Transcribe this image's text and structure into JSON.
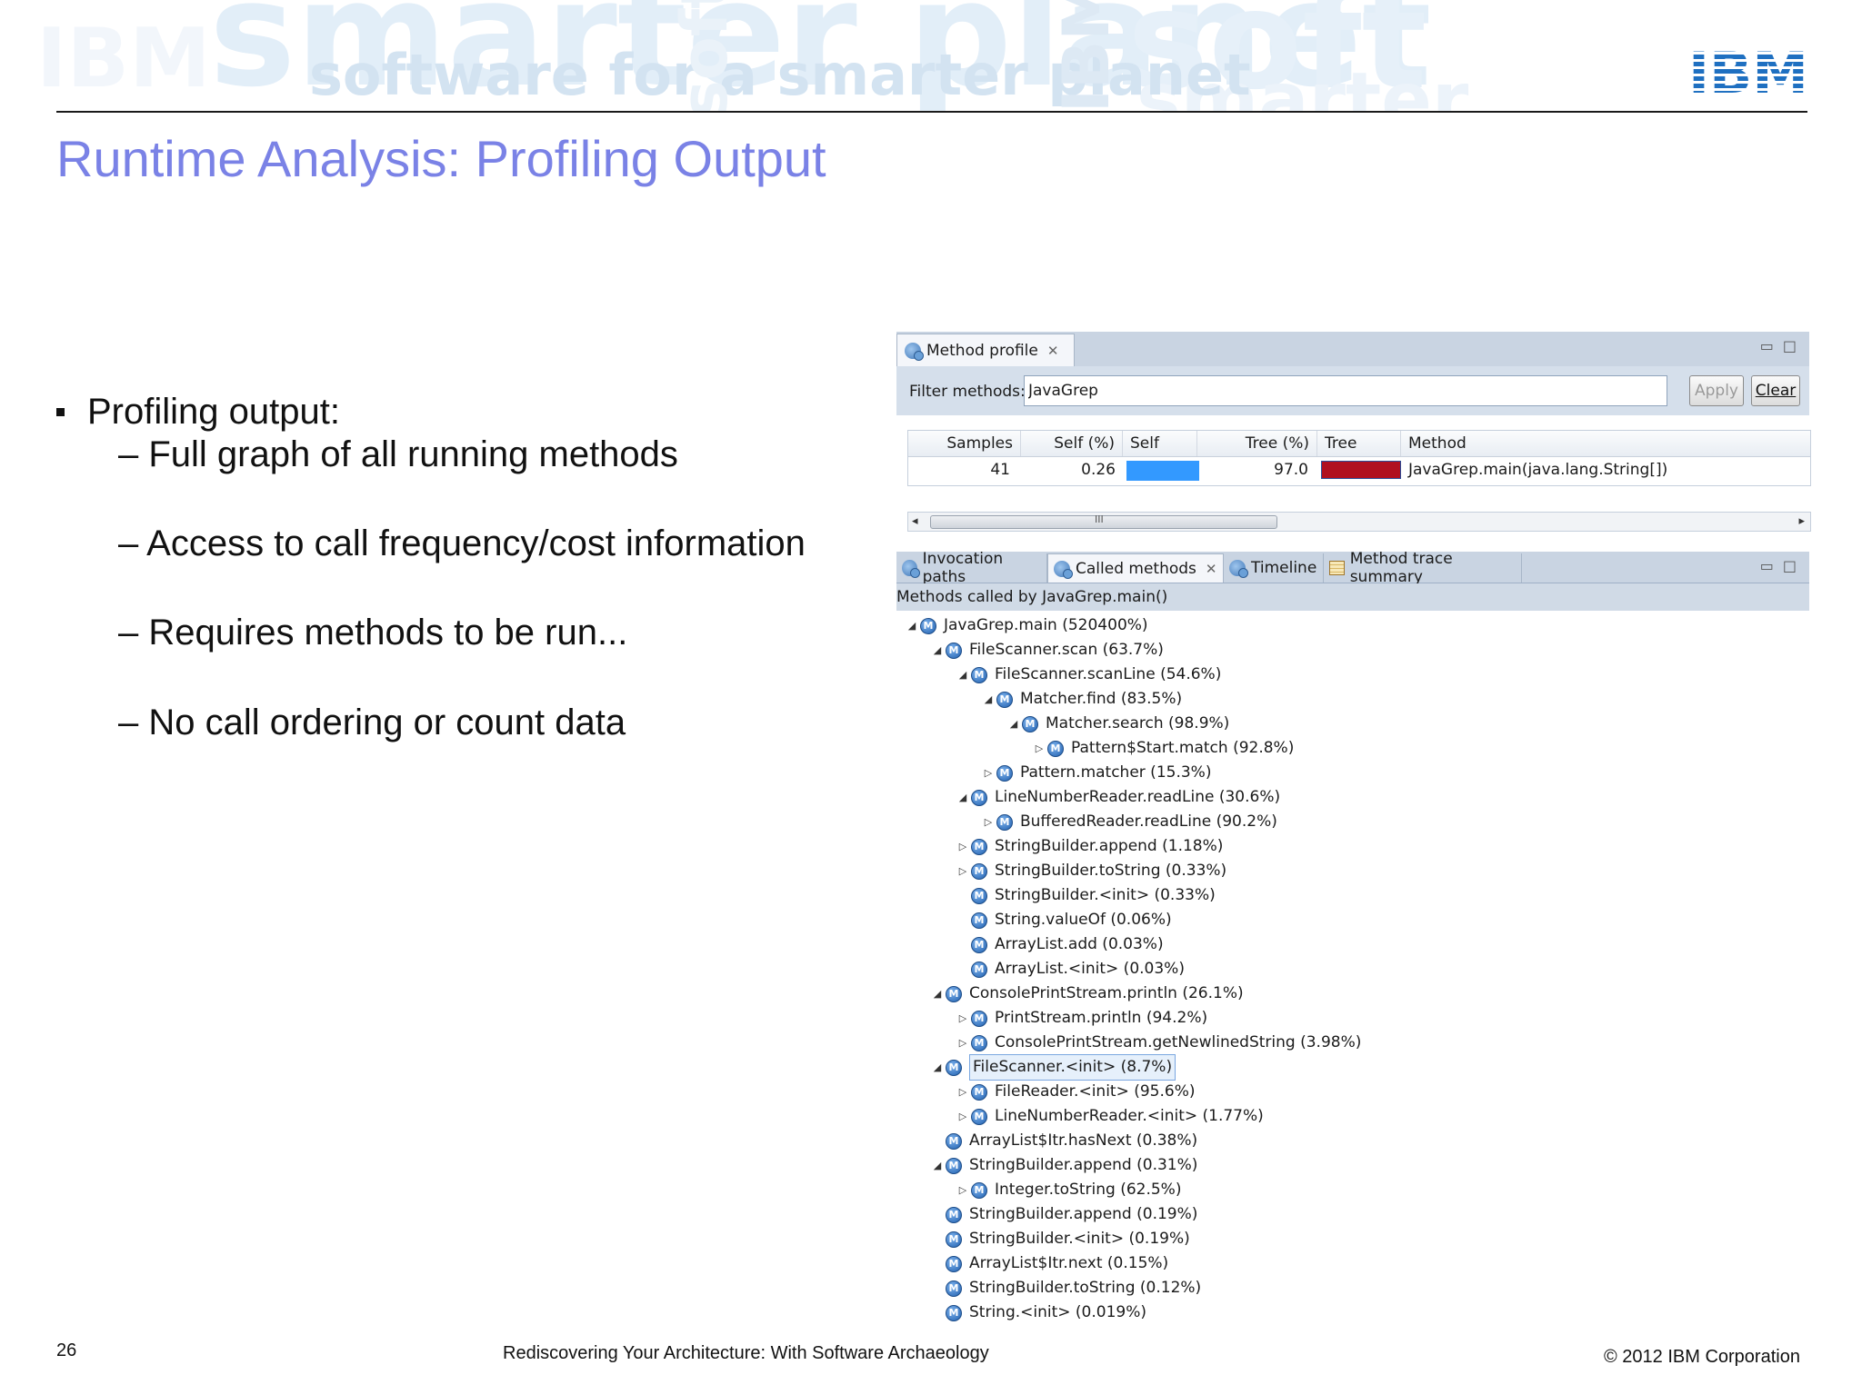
{
  "banner": {
    "watermark_1": "smarter planet",
    "watermark_2": "soft",
    "watermark_3": "software for a smarter planet",
    "watermark_4": "smarter",
    "watermark_5": "soft",
    "watermark_6": "IBM",
    "watermark_7": "IBM",
    "logo_text": "IBM"
  },
  "slide": {
    "title": "Runtime Analysis: Profiling Output",
    "bullet": "Profiling output:",
    "subbullets": [
      "– Full graph of all running methods",
      "– Access to call frequency/cost information",
      "– Requires methods to be run...",
      "– No call ordering or count data"
    ]
  },
  "profile_view": {
    "tab_label": "Method profile",
    "filter_label": "Filter methods:",
    "filter_value": "JavaGrep",
    "apply_label": "Apply",
    "clear_label": "Clear",
    "columns": [
      "Samples",
      "Self (%)",
      "Self",
      "Tree (%)",
      "Tree",
      "Method"
    ],
    "row": {
      "samples": "41",
      "self_pct": "0.26",
      "tree_pct": "97.0",
      "method": "JavaGrep.main(java.lang.String[])"
    },
    "scroll_thumb_glyph": "III"
  },
  "called_view": {
    "tabs": [
      "Invocation paths",
      "Called methods",
      "Timeline",
      "Method trace summary"
    ],
    "header": "Methods called by JavaGrep.main()",
    "nodes": [
      {
        "label": "JavaGrep.main (520400%)",
        "depth": 0,
        "state": "expanded"
      },
      {
        "label": "FileScanner.scan (63.7%)",
        "depth": 1,
        "state": "expanded"
      },
      {
        "label": "FileScanner.scanLine (54.6%)",
        "depth": 2,
        "state": "expanded"
      },
      {
        "label": "Matcher.find (83.5%)",
        "depth": 3,
        "state": "expanded"
      },
      {
        "label": "Matcher.search (98.9%)",
        "depth": 4,
        "state": "expanded"
      },
      {
        "label": "Pattern$Start.match (92.8%)",
        "depth": 5,
        "state": "collapsed"
      },
      {
        "label": "Pattern.matcher (15.3%)",
        "depth": 3,
        "state": "collapsed"
      },
      {
        "label": "LineNumberReader.readLine (30.6%)",
        "depth": 2,
        "state": "expanded"
      },
      {
        "label": "BufferedReader.readLine (90.2%)",
        "depth": 3,
        "state": "collapsed"
      },
      {
        "label": "StringBuilder.append (1.18%)",
        "depth": 2,
        "state": "collapsed"
      },
      {
        "label": "StringBuilder.toString (0.33%)",
        "depth": 2,
        "state": "collapsed"
      },
      {
        "label": "StringBuilder.<init> (0.33%)",
        "depth": 2,
        "state": "leaf"
      },
      {
        "label": "String.valueOf (0.06%)",
        "depth": 2,
        "state": "leaf"
      },
      {
        "label": "ArrayList.add (0.03%)",
        "depth": 2,
        "state": "leaf"
      },
      {
        "label": "ArrayList.<init> (0.03%)",
        "depth": 2,
        "state": "leaf"
      },
      {
        "label": "ConsolePrintStream.println (26.1%)",
        "depth": 1,
        "state": "expanded"
      },
      {
        "label": "PrintStream.println (94.2%)",
        "depth": 2,
        "state": "collapsed"
      },
      {
        "label": "ConsolePrintStream.getNewlinedString (3.98%)",
        "depth": 2,
        "state": "collapsed"
      },
      {
        "label": "FileScanner.<init> (8.7%)",
        "depth": 1,
        "state": "expanded",
        "selected": true
      },
      {
        "label": "FileReader.<init> (95.6%)",
        "depth": 2,
        "state": "collapsed"
      },
      {
        "label": "LineNumberReader.<init> (1.77%)",
        "depth": 2,
        "state": "collapsed"
      },
      {
        "label": "ArrayList$Itr.hasNext (0.38%)",
        "depth": 1,
        "state": "leaf"
      },
      {
        "label": "StringBuilder.append (0.31%)",
        "depth": 1,
        "state": "expanded"
      },
      {
        "label": "Integer.toString (62.5%)",
        "depth": 2,
        "state": "collapsed"
      },
      {
        "label": "StringBuilder.append (0.19%)",
        "depth": 1,
        "state": "leaf"
      },
      {
        "label": "StringBuilder.<init> (0.19%)",
        "depth": 1,
        "state": "leaf"
      },
      {
        "label": "ArrayList$Itr.next (0.15%)",
        "depth": 1,
        "state": "leaf"
      },
      {
        "label": "StringBuilder.toString (0.12%)",
        "depth": 1,
        "state": "leaf"
      },
      {
        "label": "String.<init> (0.019%)",
        "depth": 1,
        "state": "leaf"
      }
    ]
  },
  "footer": {
    "page_number": "26",
    "center": "Rediscovering Your Architecture: With Software Archaeology",
    "copyright": "© 2012 IBM Corporation"
  },
  "colors": {
    "title": "#7a82e6",
    "ibm_blue": "#1f70c1",
    "self_bar": "#3399ff",
    "tree_bar": "#b01020"
  }
}
